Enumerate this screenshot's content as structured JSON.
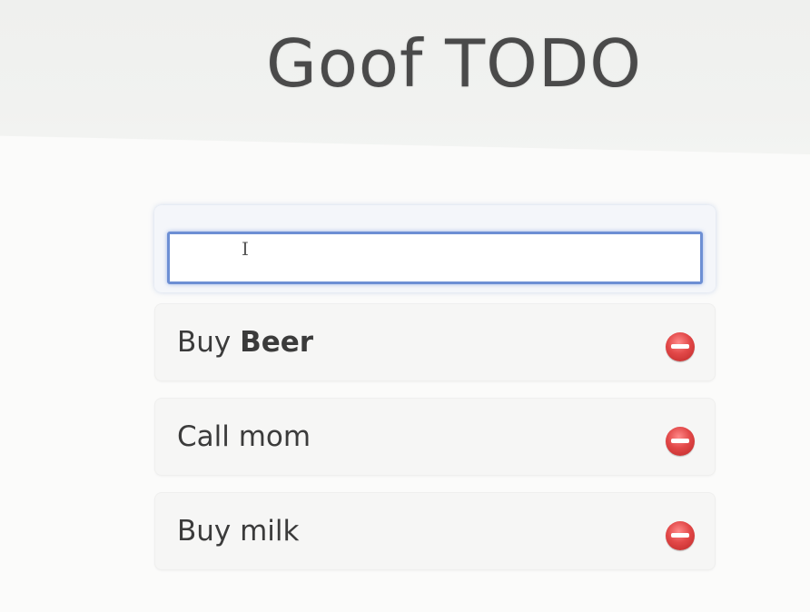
{
  "app": {
    "title": "Goof TODO"
  },
  "new_todo": {
    "value": "",
    "placeholder": "",
    "cursor_glyph": "I"
  },
  "todos": [
    {
      "prefix": "Buy ",
      "emphasis": "Beer",
      "delete_icon": "minus-circle-icon"
    },
    {
      "prefix": "Call mom",
      "emphasis": "",
      "delete_icon": "minus-circle-icon"
    },
    {
      "prefix": "Buy milk",
      "emphasis": "",
      "delete_icon": "minus-circle-icon"
    }
  ],
  "colors": {
    "header_bg": "#f0f1ef",
    "input_focus_border": "#6d8fd4",
    "item_bg": "#f6f6f5",
    "delete_red": "#e24848"
  }
}
